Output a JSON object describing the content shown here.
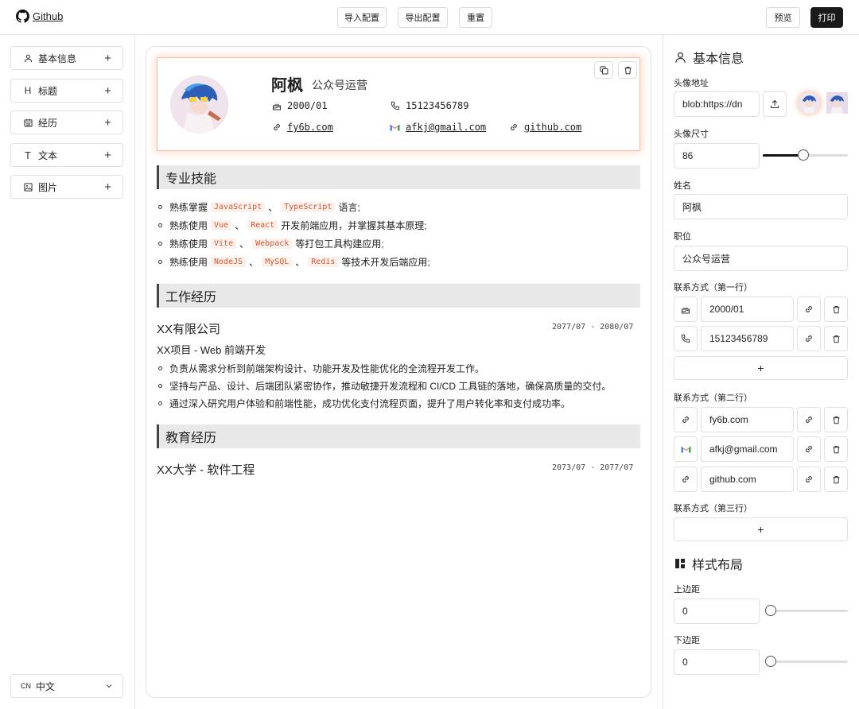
{
  "topbar": {
    "github_label": "Github",
    "import_label": "导入配置",
    "export_label": "导出配置",
    "reset_label": "重置",
    "preview_label": "预览",
    "print_label": "打印"
  },
  "sidebar": {
    "items": [
      {
        "label": "基本信息",
        "icon": "user-icon"
      },
      {
        "label": "标题",
        "icon": "heading-icon"
      },
      {
        "label": "经历",
        "icon": "calendar-icon"
      },
      {
        "label": "文本",
        "icon": "text-icon"
      },
      {
        "label": "图片",
        "icon": "image-icon"
      }
    ],
    "language": {
      "code": "CN",
      "label": "中文"
    }
  },
  "resume": {
    "name": "阿枫",
    "title": "公众号运营",
    "contacts": {
      "birth": "2000/01",
      "phone": "15123456789",
      "site": "fy6b.com",
      "email": "afkj@gmail.com",
      "github": "github.com"
    },
    "skills_title": "专业技能",
    "skills": [
      {
        "pre": "熟练掌握",
        "codes": [
          "JavaScript",
          "TypeScript"
        ],
        "sep": "、",
        "post": "语言;"
      },
      {
        "pre": "熟练使用",
        "codes": [
          "Vue",
          "React"
        ],
        "sep": "、",
        "post": "开发前端应用，并掌握其基本原理;"
      },
      {
        "pre": "熟练使用",
        "codes": [
          "Vite",
          "Webpack"
        ],
        "sep": "、",
        "post": "等打包工具构建应用;"
      },
      {
        "pre": "熟练使用",
        "codes": [
          "NodeJS",
          "MySQL",
          "Redis"
        ],
        "sep": "、",
        "post": "等技术开发后端应用;"
      }
    ],
    "work_title": "工作经历",
    "company": "XX有限公司",
    "work_date": "2077/07 - 2080/07",
    "project": "XX项目 - Web 前端开发",
    "work_points": [
      "负责从需求分析到前端架构设计、功能开发及性能优化的全流程开发工作。",
      "坚持与产品、设计、后端团队紧密协作，推动敏捷开发流程和 CI/CD 工具链的落地，确保高质量的交付。",
      "通过深入研究用户体验和前端性能，成功优化支付流程页面，提升了用户转化率和支付成功率。"
    ],
    "edu_title": "教育经历",
    "school": "XX大学 - 软件工程",
    "edu_date": "2073/07 - 2077/07"
  },
  "panel": {
    "basic_title": "基本信息",
    "avatar_url_label": "头像地址",
    "avatar_url_value": "blob:https://dn",
    "avatar_size_label": "头像尺寸",
    "avatar_size_value": "86",
    "avatar_size_level": 0.48,
    "name_label": "姓名",
    "name_value": "阿枫",
    "job_label": "职位",
    "job_value": "公众号运营",
    "row1_label": "联系方式（第一行）",
    "row1": [
      {
        "icon": "cake-icon",
        "value": "2000/01"
      },
      {
        "icon": "phone-icon",
        "value": "15123456789"
      }
    ],
    "row2_label": "联系方式（第二行）",
    "row2": [
      {
        "icon": "link-icon",
        "value": "fy6b.com"
      },
      {
        "icon": "gmail-icon",
        "value": "afkj@gmail.com"
      },
      {
        "icon": "link-icon",
        "value": "github.com"
      }
    ],
    "row3_label": "联系方式（第三行）",
    "add_label": "+",
    "layout_title": "样式布局",
    "top_margin_label": "上边距",
    "top_margin_value": "0",
    "bottom_margin_label": "下边距",
    "bottom_margin_value": "0"
  },
  "colors": {
    "accent": "#d9582f",
    "code_bg": "#fbf1ec",
    "section_bg": "#e8e8e8",
    "dark_button": "#1a1a1a"
  }
}
